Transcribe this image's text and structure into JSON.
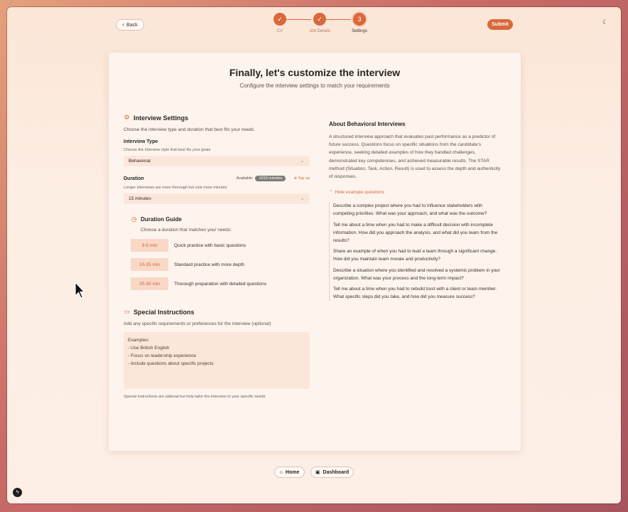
{
  "header": {
    "back_label": "Back",
    "submit_label": "Submit",
    "steps": [
      {
        "label": "CV",
        "state": "done",
        "icon": "check-icon"
      },
      {
        "label": "Job Details",
        "state": "done",
        "icon": "check-icon"
      },
      {
        "label": "Settings",
        "state": "current",
        "number": "3"
      }
    ]
  },
  "card": {
    "title": "Finally, let's customize the interview",
    "subtitle": "Configure the interview settings to match your requirements"
  },
  "interview_settings": {
    "heading": "Interview Settings",
    "description": "Choose the interview type and duration that best fits your needs",
    "type_label": "Interview Type",
    "type_hint": "Choose the interview style that best fits your goals",
    "type_value": "Behavioral",
    "duration_label": "Duration",
    "available_label": "Available:",
    "available_value": "1013 minutes",
    "top_up_label": "Top up",
    "duration_hint": "Longer interviews are more thorough but cost more minutes",
    "duration_value": "15 minutes"
  },
  "duration_guide": {
    "heading": "Duration Guide",
    "description": "Choose a duration that matches your needs:",
    "rows": [
      {
        "range": "3-5 min",
        "desc": "Quick practice with basic questions"
      },
      {
        "range": "10-15 min",
        "desc": "Standard practice with more depth"
      },
      {
        "range": "20-30 min",
        "desc": "Thorough preparation with detailed questions"
      }
    ]
  },
  "special_instructions": {
    "heading": "Special Instructions",
    "description": "Add any specific requirements or preferences for the interview (optional)",
    "placeholder_lines": [
      "Examples:",
      "- Use British English",
      "- Focus on leadership experience",
      "- Include questions about specific projects"
    ],
    "footnote": "Special instructions are optional but help tailor the interview to your specific needs"
  },
  "about": {
    "heading": "About Behavioral Interviews",
    "body": "A structured interview approach that evaluates past performance as a predictor of future success. Questions focus on specific situations from the candidate's experience, seeking detailed examples of how they handled challenges, demonstrated key competencies, and achieved measurable results. The STAR method (Situation, Task, Action, Result) is used to assess the depth and authenticity of responses.",
    "toggle_label": "Hide example questions",
    "questions": [
      "Describe a complex project where you had to influence stakeholders with competing priorities. What was your approach, and what was the outcome?",
      "Tell me about a time when you had to make a difficult decision with incomplete information. How did you approach the analysis, and what did you learn from the results?",
      "Share an example of when you had to lead a team through a significant change. How did you maintain team morale and productivity?",
      "Describe a situation where you identified and resolved a systemic problem in your organization. What was your process and the long-term impact?",
      "Tell me about a time when you had to rebuild trust with a client or team member. What specific steps did you take, and how did you measure success?"
    ]
  },
  "footer": {
    "home_label": "Home",
    "dashboard_label": "Dashboard"
  },
  "colors": {
    "accent": "#d9683a",
    "card_bg": "#fdf4ee",
    "field_bg": "#fbe7da"
  }
}
